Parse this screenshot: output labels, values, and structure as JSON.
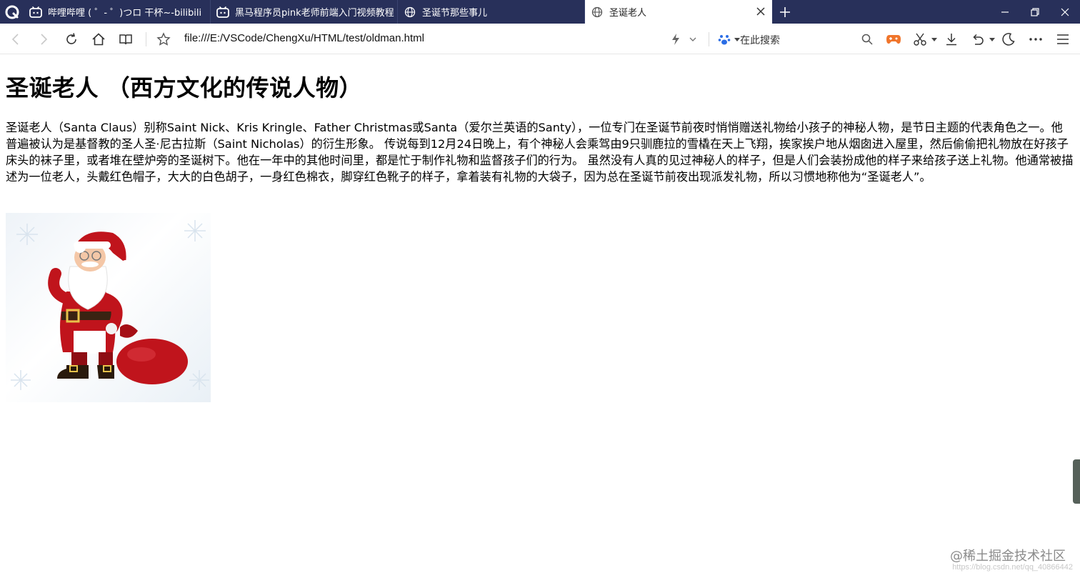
{
  "tabs": [
    {
      "title": "哔哩哔哩 ( ゜- ゜)つロ 干杯~-bilibili",
      "icon": "bilibili-icon"
    },
    {
      "title": "黑马程序员pink老师前端入门视频教程",
      "icon": "bilibili-icon"
    },
    {
      "title": "圣诞节那些事儿",
      "icon": "globe-icon"
    },
    {
      "title": "圣诞老人",
      "icon": "globe-icon",
      "active": true
    }
  ],
  "address": {
    "url": "file:///E:/VSCode/ChengXu/HTML/test/oldman.html"
  },
  "search": {
    "placeholder": "在此搜索"
  },
  "page": {
    "heading": "圣诞老人 （西方文化的传说人物）",
    "paragraph": "圣诞老人（Santa Claus）别称Saint Nick、Kris Kringle、Father Christmas或Santa（爱尔兰英语的Santy），一位专门在圣诞节前夜时悄悄赠送礼物给小孩子的神秘人物，是节日主题的代表角色之一。他普遍被认为是基督教的圣人圣·尼古拉斯（Saint Nicholas）的衍生形象。 传说每到12月24日晚上，有个神秘人会乘驾由9只驯鹿拉的雪橇在天上飞翔，挨家挨户地从烟囱进入屋里，然后偷偷把礼物放在好孩子床头的袜子里，或者堆在壁炉旁的圣诞树下。他在一年中的其他时间里，都是忙于制作礼物和监督孩子们的行为。 虽然没有人真的见过神秘人的样子，但是人们会装扮成他的样子来给孩子送上礼物。他通常被描述为一位老人，头戴红色帽子，大大的白色胡子，一身红色棉衣，脚穿红色靴子的样子，拿着装有礼物的大袋子，因为总在圣诞节前夜出现派发礼物，所以习惯地称他为“圣诞老人”。"
  },
  "watermark": {
    "text": "@稀土掘金技术社区",
    "url": "https://blog.csdn.net/qq_40866442"
  },
  "colors": {
    "tabbar": "#28305a",
    "santa_red": "#c0141c"
  }
}
